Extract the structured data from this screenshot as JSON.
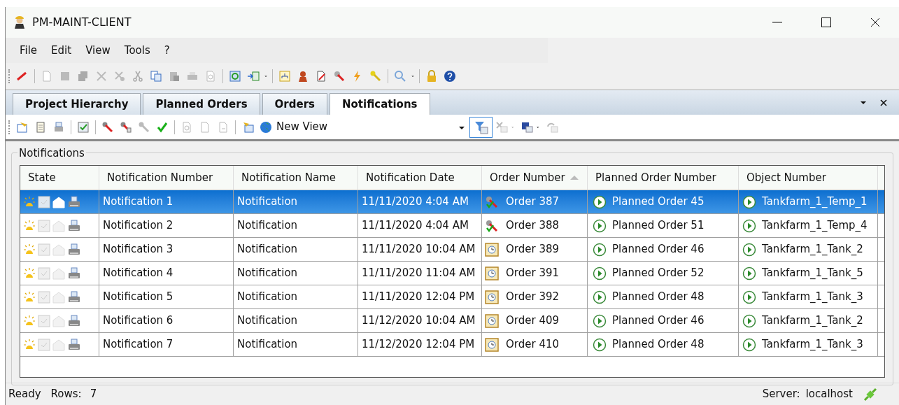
{
  "window": {
    "title": "PM-MAINT-CLIENT"
  },
  "menu": [
    "File",
    "Edit",
    "View",
    "Tools",
    "?"
  ],
  "tabs": [
    {
      "label": "Project Hierarchy",
      "selected": false
    },
    {
      "label": "Planned Orders",
      "selected": false
    },
    {
      "label": "Orders",
      "selected": false
    },
    {
      "label": "Notifications",
      "selected": true
    }
  ],
  "view_selector": {
    "value": "New View"
  },
  "group": {
    "title": "Notifications"
  },
  "table": {
    "columns": [
      {
        "label": "State",
        "sorted": false
      },
      {
        "label": "Notification Number",
        "sorted": false
      },
      {
        "label": "Notification Name",
        "sorted": false
      },
      {
        "label": "Notification Date",
        "sorted": false
      },
      {
        "label": "Order Number",
        "sorted": true
      },
      {
        "label": "Planned Order Number",
        "sorted": false
      },
      {
        "label": "Object Number",
        "sorted": false
      }
    ],
    "rows": [
      {
        "selected": true,
        "number": "Notification 1",
        "name": "Notification",
        "date": "11/11/2020 4:04 AM",
        "kind": "wrench",
        "order": "Order 387",
        "planned_order": "Planned Order 45",
        "object": "Tankfarm_1_Temp_1"
      },
      {
        "selected": false,
        "number": "Notification 2",
        "name": "Notification",
        "date": "11/11/2020 4:04 AM",
        "kind": "wrench",
        "order": "Order 388",
        "planned_order": "Planned Order 51",
        "object": "Tankfarm_1_Temp_4"
      },
      {
        "selected": false,
        "number": "Notification 3",
        "name": "Notification",
        "date": "11/11/2020 10:04 AM",
        "kind": "clock",
        "order": "Order 389",
        "planned_order": "Planned Order 46",
        "object": "Tankfarm_1_Tank_2"
      },
      {
        "selected": false,
        "number": "Notification 4",
        "name": "Notification",
        "date": "11/11/2020 11:04 AM",
        "kind": "clock",
        "order": "Order 391",
        "planned_order": "Planned Order 52",
        "object": "Tankfarm_1_Tank_5"
      },
      {
        "selected": false,
        "number": "Notification 5",
        "name": "Notification",
        "date": "11/11/2020 12:04 PM",
        "kind": "clock",
        "order": "Order 392",
        "planned_order": "Planned Order 48",
        "object": "Tankfarm_1_Tank_3"
      },
      {
        "selected": false,
        "number": "Notification 6",
        "name": "Notification",
        "date": "11/12/2020 10:04 AM",
        "kind": "clock",
        "order": "Order 409",
        "planned_order": "Planned Order 46",
        "object": "Tankfarm_1_Tank_2"
      },
      {
        "selected": false,
        "number": "Notification 7",
        "name": "Notification",
        "date": "11/12/2020 12:04 PM",
        "kind": "clock",
        "order": "Order 410",
        "planned_order": "Planned Order 48",
        "object": "Tankfarm_1_Tank_3"
      }
    ]
  },
  "status_bar": {
    "state": "Ready",
    "rows_label": "Rows:",
    "rows": "7",
    "server_label": "Server:",
    "server": "localhost"
  }
}
